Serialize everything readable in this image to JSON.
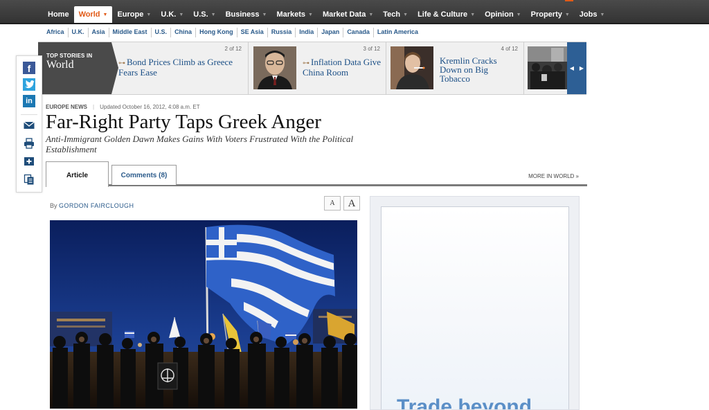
{
  "nav": {
    "items": [
      {
        "label": "Home",
        "active": false,
        "arrow": false
      },
      {
        "label": "World",
        "active": true,
        "arrow": true
      },
      {
        "label": "Europe",
        "active": false,
        "arrow": true
      },
      {
        "label": "U.K.",
        "active": false,
        "arrow": true
      },
      {
        "label": "U.S.",
        "active": false,
        "arrow": true
      },
      {
        "label": "Business",
        "active": false,
        "arrow": true
      },
      {
        "label": "Markets",
        "active": false,
        "arrow": true
      },
      {
        "label": "Market Data",
        "active": false,
        "arrow": true
      },
      {
        "label": "Tech",
        "active": false,
        "arrow": true
      },
      {
        "label": "Life & Culture",
        "active": false,
        "arrow": true
      },
      {
        "label": "Opinion",
        "active": false,
        "arrow": true
      },
      {
        "label": "Property",
        "active": false,
        "arrow": true
      },
      {
        "label": "Jobs",
        "active": false,
        "arrow": true
      }
    ],
    "arrow_glyph": "▼"
  },
  "subnav": [
    "Africa",
    "U.K.",
    "Asia",
    "Middle East",
    "U.S.",
    "China",
    "Hong Kong",
    "SE Asia",
    "Russia",
    "India",
    "Japan",
    "Canada",
    "Latin America"
  ],
  "top_stories": {
    "label_small": "TOP STORIES IN",
    "label_big": "World",
    "stories": [
      {
        "counter": "2 of 12",
        "headline": "Bond Prices Climb as Greece Fears Ease"
      },
      {
        "counter": "3 of 12",
        "headline": "Inflation Data Give China Room"
      },
      {
        "counter": "4 of 12",
        "headline": "Kremlin Cracks Down on Big Tobacco"
      }
    ],
    "prev_glyph": "◀",
    "next_glyph": "▶"
  },
  "share": {
    "facebook": "f",
    "linkedin": "in"
  },
  "article": {
    "section": "EUROPE NEWS",
    "separator": "|",
    "updated": "Updated October 16, 2012, 4:08 a.m. ET",
    "title": "Far-Right Party Taps Greek Anger",
    "dek": "Anti-Immigrant Golden Dawn Makes Gains With Voters Frustrated With the Political Establishment",
    "by": "By",
    "author": "GORDON FAIRCLOUGH",
    "font_small": "A",
    "font_large": "A"
  },
  "tabs": {
    "article": "Article",
    "comments": "Comments (8)",
    "more": "MORE IN WORLD »"
  },
  "ad": {
    "text": "Trade beyond"
  },
  "colors": {
    "nav_bg": "#3c3c3c",
    "active_accent": "#e15a17",
    "link_blue": "#1b4f86",
    "carousel_blue": "#2d5f95"
  }
}
